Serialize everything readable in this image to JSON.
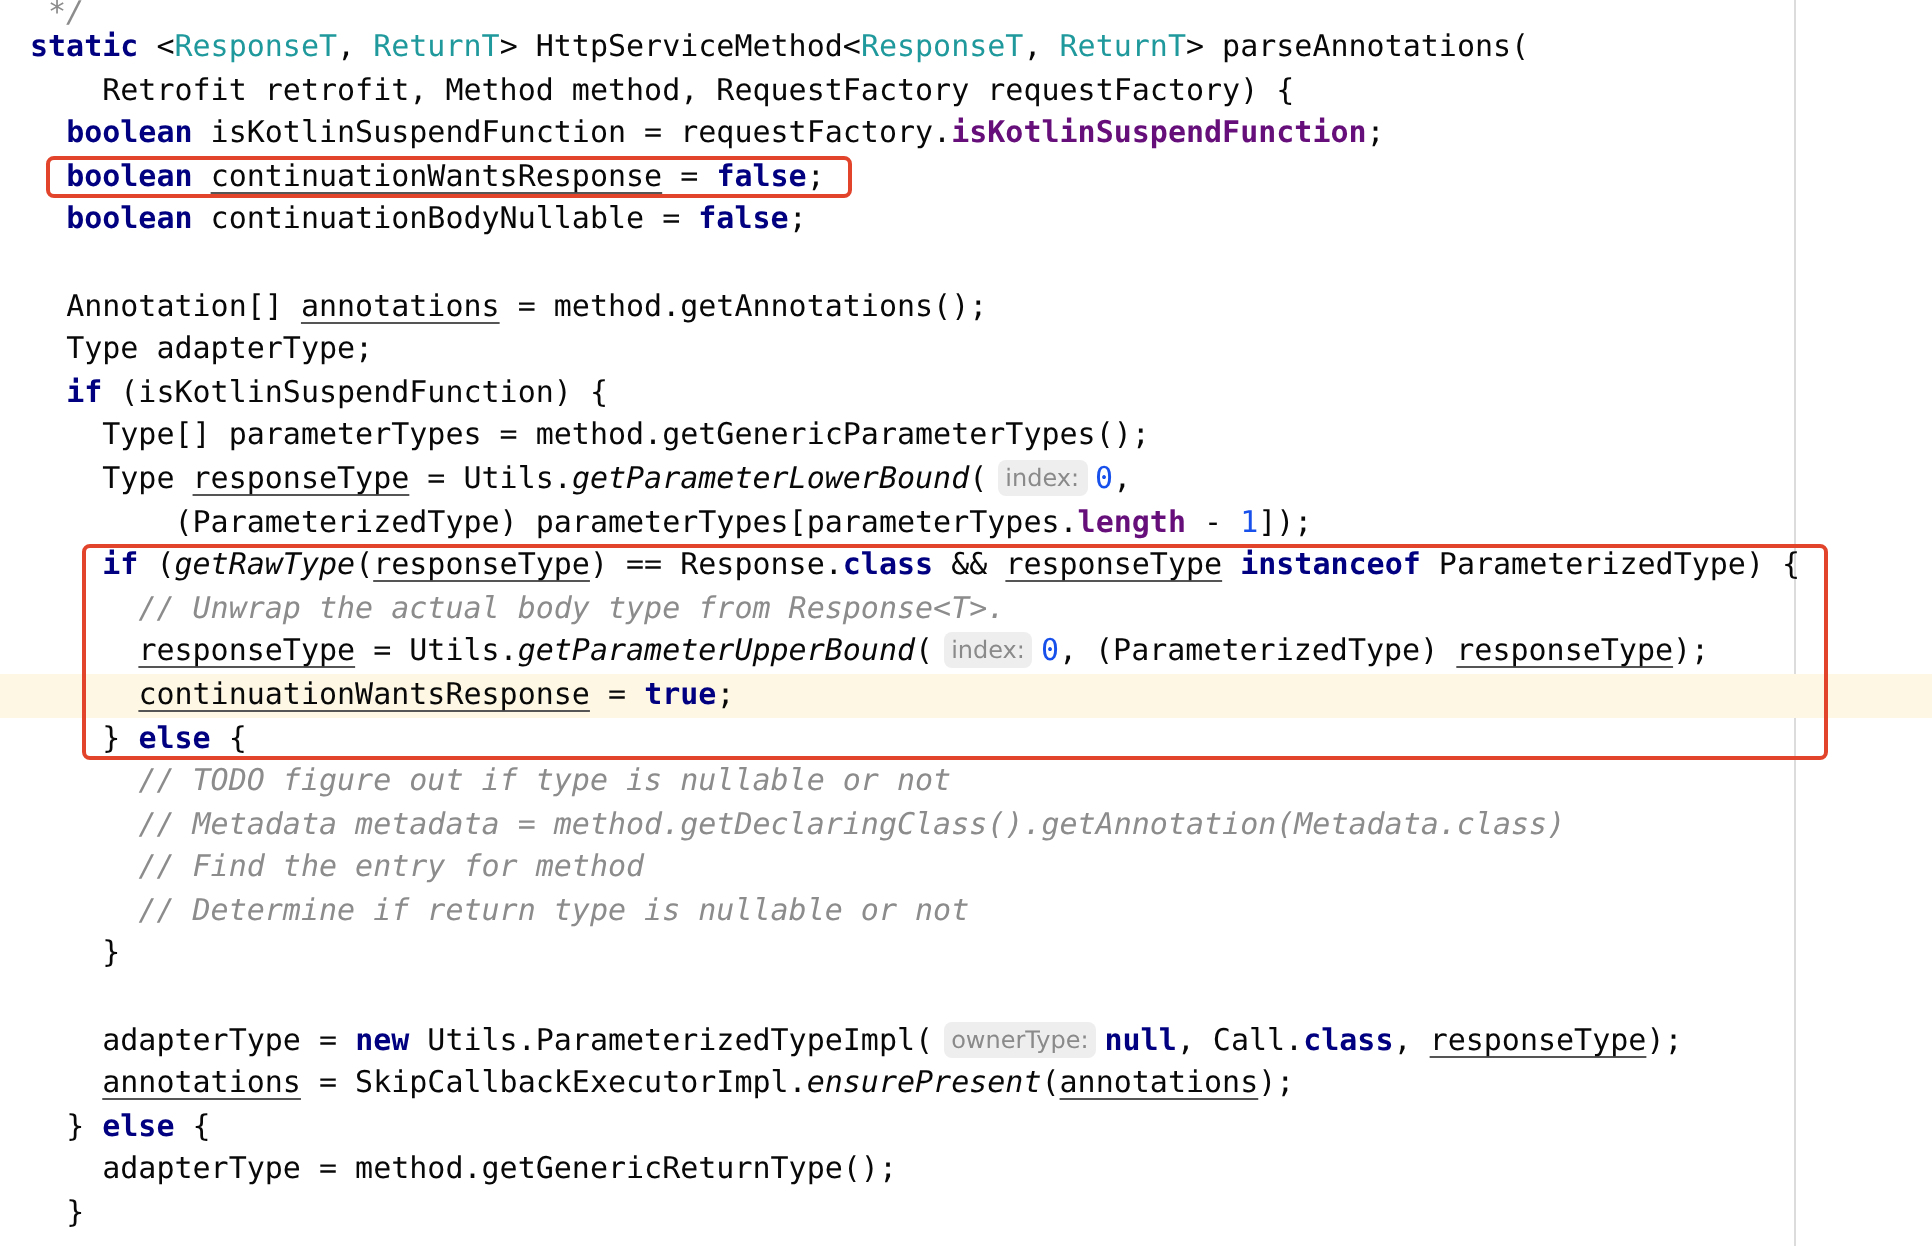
{
  "editor": {
    "blocks": [
      {
        "boxed": false,
        "lines": [
          {
            "current": false,
            "tokens": [
              {
                "kind": "comment",
                "text": " */"
              }
            ]
          },
          {
            "current": false,
            "tokens": [
              {
                "kind": "keyword",
                "text": "static"
              },
              {
                "kind": "plain",
                "text": " <"
              },
              {
                "kind": "type_param",
                "text": "ResponseT"
              },
              {
                "kind": "plain",
                "text": ", "
              },
              {
                "kind": "type_param",
                "text": "ReturnT"
              },
              {
                "kind": "plain",
                "text": "> HttpServiceMethod<"
              },
              {
                "kind": "type_param",
                "text": "ResponseT"
              },
              {
                "kind": "plain",
                "text": ", "
              },
              {
                "kind": "type_param",
                "text": "ReturnT"
              },
              {
                "kind": "plain",
                "text": "> parseAnnotations("
              }
            ]
          },
          {
            "current": false,
            "tokens": [
              {
                "kind": "plain",
                "text": "    Retrofit retrofit, Method method, RequestFactory requestFactory) {"
              }
            ]
          },
          {
            "current": false,
            "tokens": [
              {
                "kind": "keyword",
                "text": "  boolean"
              },
              {
                "kind": "plain",
                "text": " isKotlinSuspendFunction = requestFactory."
              },
              {
                "kind": "field",
                "text": "isKotlinSuspendFunction"
              },
              {
                "kind": "plain",
                "text": ";"
              }
            ]
          }
        ]
      },
      {
        "boxed": true,
        "lines": [
          {
            "current": false,
            "tokens": [
              {
                "kind": "keyword",
                "text": "  boolean "
              },
              {
                "kind": "underlined",
                "text": "continuationWantsResponse"
              },
              {
                "kind": "plain",
                "text": " = "
              },
              {
                "kind": "keyword",
                "text": "false"
              },
              {
                "kind": "plain",
                "text": ";"
              }
            ]
          }
        ]
      },
      {
        "boxed": false,
        "lines": [
          {
            "current": false,
            "tokens": [
              {
                "kind": "keyword",
                "text": "  boolean"
              },
              {
                "kind": "plain",
                "text": " continuationBodyNullable = "
              },
              {
                "kind": "keyword",
                "text": "false"
              },
              {
                "kind": "plain",
                "text": ";"
              }
            ]
          },
          {
            "current": false
          },
          {
            "current": false,
            "tokens": [
              {
                "kind": "plain",
                "text": "  Annotation[] "
              },
              {
                "kind": "underlined",
                "text": "annotations"
              },
              {
                "kind": "plain",
                "text": " = method.getAnnotations();"
              }
            ]
          },
          {
            "current": false,
            "tokens": [
              {
                "kind": "plain",
                "text": "  Type adapterType;"
              }
            ]
          },
          {
            "current": false,
            "tokens": [
              {
                "kind": "keyword",
                "text": "  if"
              },
              {
                "kind": "plain",
                "text": " (isKotlinSuspendFunction) {"
              }
            ]
          },
          {
            "current": false,
            "tokens": [
              {
                "kind": "plain",
                "text": "    Type[] parameterTypes = method.getGenericParameterTypes();"
              }
            ]
          },
          {
            "current": false,
            "tokens": [
              {
                "kind": "plain",
                "text": "    Type "
              },
              {
                "kind": "underlined",
                "text": "responseType"
              },
              {
                "kind": "plain",
                "text": " = Utils."
              },
              {
                "kind": "call",
                "text": "getParameterLowerBound"
              },
              {
                "kind": "plain",
                "text": "("
              },
              {
                "kind": "hint",
                "text": "index:"
              },
              {
                "kind": "number",
                "text": "0"
              },
              {
                "kind": "plain",
                "text": ","
              }
            ]
          },
          {
            "current": false,
            "tokens": [
              {
                "kind": "plain",
                "text": "        (ParameterizedType) parameterTypes[parameterTypes."
              },
              {
                "kind": "field",
                "text": "length"
              },
              {
                "kind": "plain",
                "text": " - "
              },
              {
                "kind": "number",
                "text": "1"
              },
              {
                "kind": "plain",
                "text": "]);"
              }
            ]
          }
        ]
      },
      {
        "boxed": true,
        "lines": [
          {
            "current": false,
            "tokens": [
              {
                "kind": "keyword",
                "text": "    if"
              },
              {
                "kind": "plain",
                "text": " ("
              },
              {
                "kind": "call",
                "text": "getRawType"
              },
              {
                "kind": "plain",
                "text": "("
              },
              {
                "kind": "underlined",
                "text": "responseType"
              },
              {
                "kind": "plain",
                "text": ") == Response."
              },
              {
                "kind": "keyword",
                "text": "class"
              },
              {
                "kind": "plain",
                "text": " && "
              },
              {
                "kind": "underlined",
                "text": "responseType"
              },
              {
                "kind": "keyword",
                "text": " instanceof"
              },
              {
                "kind": "plain",
                "text": " ParameterizedType) {"
              }
            ]
          },
          {
            "current": false,
            "tokens": [
              {
                "kind": "comment",
                "text": "      // Unwrap the actual body type from Response<T>."
              }
            ]
          },
          {
            "current": false,
            "tokens": [
              {
                "kind": "underlined",
                "text": "      responseType"
              },
              {
                "kind": "plain",
                "text": " = Utils."
              },
              {
                "kind": "call",
                "text": "getParameterUpperBound"
              },
              {
                "kind": "plain",
                "text": "("
              },
              {
                "kind": "hint",
                "text": "index:"
              },
              {
                "kind": "number",
                "text": "0"
              },
              {
                "kind": "plain",
                "text": ", (ParameterizedType) "
              },
              {
                "kind": "underlined",
                "text": "responseType"
              },
              {
                "kind": "plain",
                "text": ");"
              }
            ]
          },
          {
            "current": true,
            "tokens": [
              {
                "kind": "underlined",
                "text": "      continuationWantsResponse"
              },
              {
                "kind": "plain",
                "text": " = "
              },
              {
                "kind": "keyword",
                "text": "true"
              },
              {
                "kind": "plain",
                "text": ";"
              }
            ]
          },
          {
            "current": false,
            "tokens": [
              {
                "kind": "plain",
                "text": "    } "
              },
              {
                "kind": "keyword",
                "text": "else"
              },
              {
                "kind": "plain",
                "text": " {"
              }
            ]
          }
        ]
      },
      {
        "boxed": false,
        "lines": [
          {
            "current": false,
            "tokens": [
              {
                "kind": "comment",
                "text": "      // TODO figure out if type is nullable or not"
              }
            ]
          },
          {
            "current": false,
            "tokens": [
              {
                "kind": "comment",
                "text": "      // Metadata metadata = method.getDeclaringClass().getAnnotation(Metadata.class)"
              }
            ]
          },
          {
            "current": false,
            "tokens": [
              {
                "kind": "comment",
                "text": "      // Find the entry for method"
              }
            ]
          },
          {
            "current": false,
            "tokens": [
              {
                "kind": "comment",
                "text": "      // Determine if return type is nullable or not"
              }
            ]
          },
          {
            "current": false,
            "tokens": [
              {
                "kind": "plain",
                "text": "    }"
              }
            ]
          },
          {
            "current": false
          },
          {
            "current": false,
            "tokens": [
              {
                "kind": "plain",
                "text": "    adapterType = "
              },
              {
                "kind": "keyword",
                "text": "new"
              },
              {
                "kind": "plain",
                "text": " Utils.ParameterizedTypeImpl("
              },
              {
                "kind": "hint",
                "text": "ownerType:"
              },
              {
                "kind": "keyword",
                "text": "null"
              },
              {
                "kind": "plain",
                "text": ", Call."
              },
              {
                "kind": "keyword",
                "text": "class"
              },
              {
                "kind": "plain",
                "text": ", "
              },
              {
                "kind": "underlined",
                "text": "responseType"
              },
              {
                "kind": "plain",
                "text": ");"
              }
            ]
          },
          {
            "current": false,
            "tokens": [
              {
                "kind": "underlined",
                "text": "    annotations"
              },
              {
                "kind": "plain",
                "text": " = SkipCallbackExecutorImpl."
              },
              {
                "kind": "call",
                "text": "ensurePresent"
              },
              {
                "kind": "plain",
                "text": "("
              },
              {
                "kind": "underlined",
                "text": "annotations"
              },
              {
                "kind": "plain",
                "text": ");"
              }
            ]
          },
          {
            "current": false,
            "tokens": [
              {
                "kind": "plain",
                "text": "  } "
              },
              {
                "kind": "keyword",
                "text": "else"
              },
              {
                "kind": "plain",
                "text": " {"
              }
            ]
          },
          {
            "current": false,
            "tokens": [
              {
                "kind": "plain",
                "text": "    adapterType = method.getGenericReturnType();"
              }
            ]
          },
          {
            "current": false,
            "tokens": [
              {
                "kind": "plain",
                "text": "  }"
              }
            ]
          }
        ]
      }
    ]
  }
}
